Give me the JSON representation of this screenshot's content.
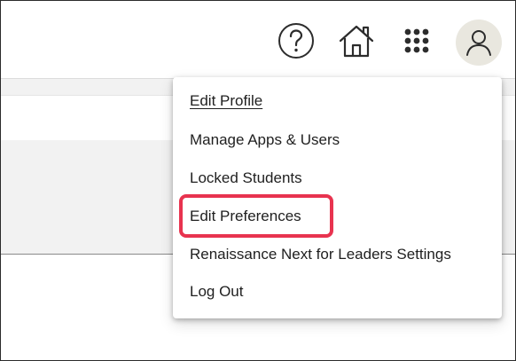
{
  "header": {
    "icons": [
      "help-icon",
      "home-icon",
      "apps-grid-icon",
      "user-avatar-icon"
    ]
  },
  "user_menu": {
    "items": [
      {
        "label": "Edit Profile"
      },
      {
        "label": "Manage Apps & Users"
      },
      {
        "label": "Locked Students"
      },
      {
        "label": "Edit Preferences"
      },
      {
        "label": "Renaissance Next for Leaders Settings"
      },
      {
        "label": "Log Out"
      }
    ],
    "highlighted_item": "Edit Preferences"
  },
  "colors": {
    "highlight": "#e8334f",
    "avatar_bg": "#e9e7df",
    "icon": "#2c2c2c",
    "background_gray": "#f2f2f2"
  }
}
